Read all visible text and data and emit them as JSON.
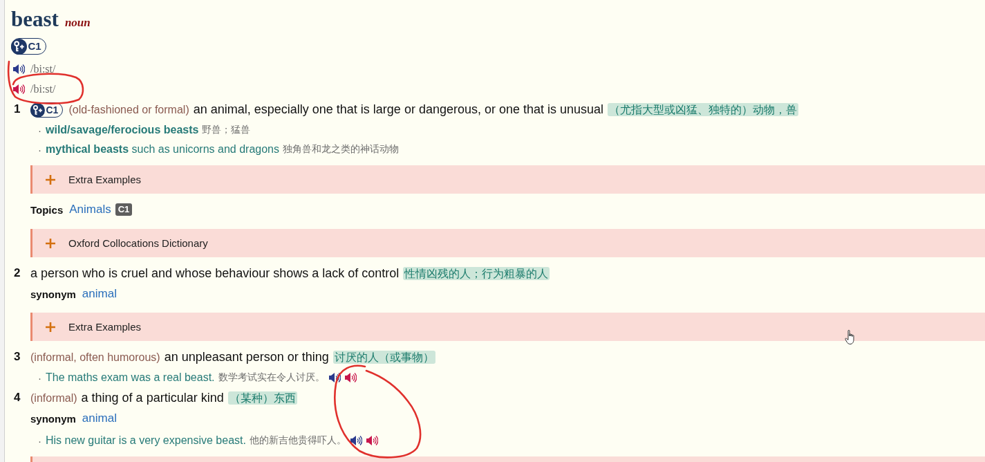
{
  "entry": {
    "headword": "beast",
    "part_of_speech": "noun",
    "level": "C1"
  },
  "pronunciations": [
    {
      "text": "/bi:st/",
      "color": "#2b3a8c"
    },
    {
      "text": "/bi:st/",
      "color": "#c8174c"
    }
  ],
  "senses": [
    {
      "number": "1",
      "level": "C1",
      "register": "(old-fashioned or formal)",
      "definition": "an animal, especially one that is large or dangerous, or one that is unusual",
      "translation": "（尤指大型或凶猛、独特的）动物，兽",
      "blocks": [
        {
          "kind": "examples",
          "items": [
            {
              "bullet": "·",
              "text": "**wild/savage/ferocious beasts**",
              "translation": "野兽；猛兽"
            },
            {
              "bullet": "·",
              "text": "**mythical beasts** such as unicorns and dragons",
              "translation": "独角兽和龙之类的神话动物"
            }
          ]
        },
        {
          "kind": "expander",
          "label": "Extra Examples"
        },
        {
          "kind": "topics",
          "label": "Topics",
          "link": "Animals",
          "level": "C1"
        },
        {
          "kind": "expander",
          "label": "Oxford Collocations Dictionary"
        }
      ]
    },
    {
      "number": "2",
      "definition": "a person who is cruel and whose behaviour shows a lack of control",
      "translation": "性情凶残的人；行为粗暴的人",
      "blocks": [
        {
          "kind": "synonym",
          "label": "synonym",
          "link": "animal"
        },
        {
          "kind": "expander",
          "label": "Extra Examples"
        }
      ]
    },
    {
      "number": "3",
      "register": "(informal, often humorous)",
      "definition": "an unpleasant person or thing",
      "translation": "讨厌的人（或事物）",
      "blocks": [
        {
          "kind": "examples",
          "items": [
            {
              "bullet": "·",
              "text": "The maths exam was a real beast.",
              "translation": "数学考试实在令人讨厌。",
              "audio": [
                {
                  "color": "#2b3a8c"
                },
                {
                  "color": "#c8174c"
                }
              ]
            }
          ]
        }
      ]
    },
    {
      "number": "4",
      "register": "(informal)",
      "definition": "a thing of a particular kind",
      "translation": "（某种）东西",
      "blocks": [
        {
          "kind": "synonym",
          "label": "synonym",
          "link": "animal"
        },
        {
          "kind": "examples",
          "items": [
            {
              "bullet": "·",
              "text": "His new guitar is a very expensive beast.",
              "translation": "他的新吉他贵得吓人。",
              "audio": [
                {
                  "color": "#2b3a8c"
                },
                {
                  "color": "#c8174c"
                }
              ]
            }
          ]
        },
        {
          "kind": "expander"
        }
      ]
    }
  ]
}
